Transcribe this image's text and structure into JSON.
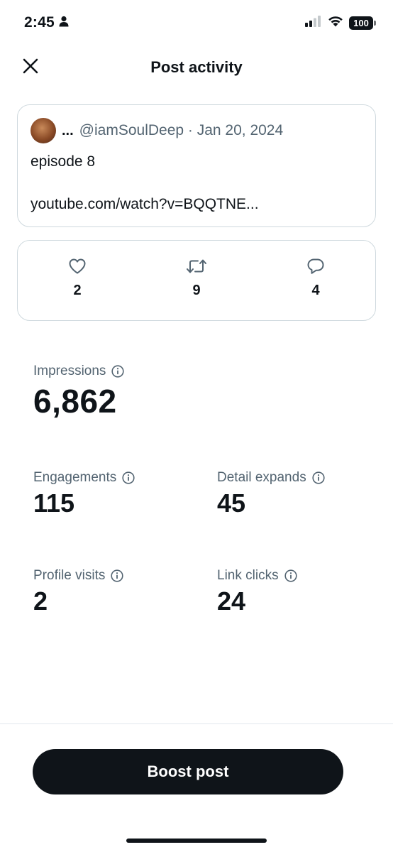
{
  "status_bar": {
    "time": "2:45",
    "battery": "100",
    "icons": [
      "person-icon",
      "signal-icon",
      "wifi-icon",
      "battery-icon"
    ]
  },
  "header": {
    "title": "Post activity",
    "close_icon": "close-icon"
  },
  "post": {
    "author_name": "...",
    "handle_date": "@iamSoulDeep · Jan 20, 2024",
    "text": "episode 8",
    "link": "youtube.com/watch?v=BQQTNE..."
  },
  "engagement": {
    "likes": "2",
    "reposts": "9",
    "replies": "4"
  },
  "metrics": {
    "impressions": {
      "label": "Impressions",
      "value": "6,862"
    },
    "engagements": {
      "label": "Engagements",
      "value": "115"
    },
    "detail_expands": {
      "label": "Detail expands",
      "value": "45"
    },
    "profile_visits": {
      "label": "Profile visits",
      "value": "2"
    },
    "link_clicks": {
      "label": "Link clicks",
      "value": "24"
    }
  },
  "actions": {
    "boost_label": "Boost post"
  },
  "colors": {
    "text_primary": "#0f1419",
    "text_secondary": "#536471",
    "border": "#cfd9de",
    "button_bg": "#0f1419"
  }
}
